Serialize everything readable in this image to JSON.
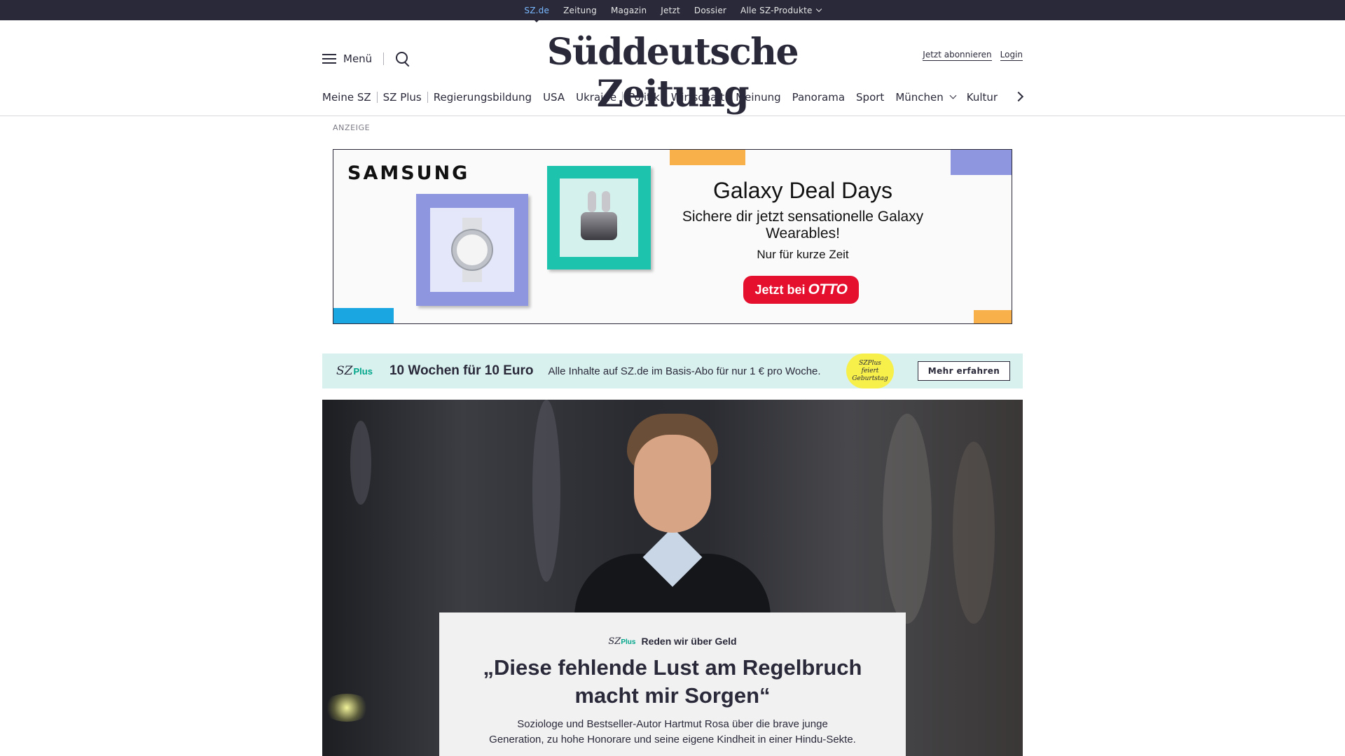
{
  "topbar": {
    "items": [
      "SZ.de",
      "Zeitung",
      "Magazin",
      "Jetzt",
      "Dossier",
      "Alle SZ-Produkte"
    ]
  },
  "header": {
    "menu_label": "Menü",
    "logo_text": "Süddeutsche Zeitung",
    "subscribe_label": "Jetzt abonnieren",
    "login_label": "Login"
  },
  "ressorts": [
    "Meine SZ",
    "SZ Plus",
    "Regierungsbildung",
    "USA",
    "Ukraine",
    "Politik",
    "Wirtschaft",
    "Meinung",
    "Panorama",
    "Sport",
    "München",
    "Kultur"
  ],
  "ad": {
    "label": "ANZEIGE",
    "brand": "SAMSUNG",
    "headline": "Galaxy Deal Days",
    "subline": "Sichere dir jetzt sensationelle Galaxy Wearables!",
    "small": "Nur für kurze Zeit",
    "cta_prefix": "Jetzt bei",
    "cta_brand": "OTTO",
    "colors": {
      "purple": "#8f96e0",
      "teal": "#1ec3ae",
      "orange": "#f7b04a",
      "blue": "#1aa6e0",
      "red": "#e5102e"
    }
  },
  "promo": {
    "logo_sz": "SZ",
    "logo_plus": "Plus",
    "offer": "10 Wochen für 10 Euro",
    "description": "Alle Inhalte auf SZ.de im Basis-Abo für nur 1 € pro Woche.",
    "badge_line1": "SZPlus",
    "badge_line2": "feiert",
    "badge_line3": "Geburtstag",
    "button_label": "Mehr erfahren"
  },
  "teaser": {
    "kicker_sz": "SZ",
    "kicker_plus": "Plus",
    "kicker_text": "Reden wir über Geld",
    "headline": "„Diese fehlende Lust am Regelbruch macht mir Sorgen“",
    "summary": "Soziologe und Bestseller-Autor Hartmut Rosa über die brave junge Generation, zu hohe Honorare und seine eigene Kindheit in einer Hindu-Sekte."
  }
}
